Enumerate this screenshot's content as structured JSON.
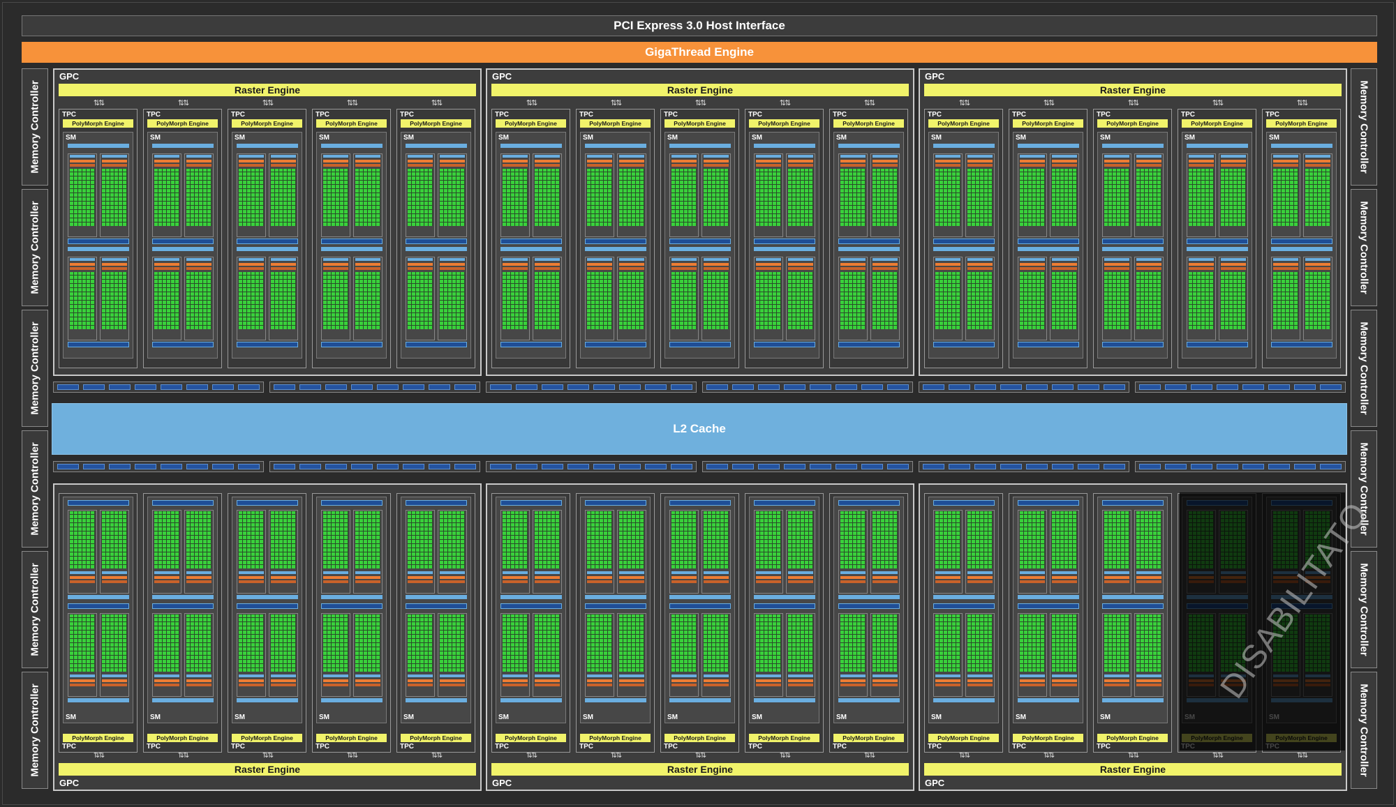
{
  "header": {
    "pci_label": "PCI Express 3.0 Host Interface",
    "gigathread_label": "GigaThread Engine"
  },
  "l2_cache_label": "L2 Cache",
  "memory_controller_label": "Memory Controller",
  "gpc_label": "GPC",
  "raster_engine_label": "Raster Engine",
  "tpc_label": "TPC",
  "polymorph_label": "PolyMorph Engine",
  "sm_label": "SM",
  "disabled_label": "DISABILITATO",
  "colors": {
    "background": "#2b2b2b",
    "gigathread": "#f7923a",
    "raster_polymorph": "#f1f36a",
    "l2_cache": "#6fb0dd",
    "cuda_core": "#39d13b",
    "load_store": "#1f4e96",
    "register_file": "#ee7d33"
  },
  "layout_summary": {
    "gpc_count": 6,
    "tpc_per_gpc": 5,
    "sm_per_tpc": 1,
    "memory_controllers": 12,
    "disabled_tpcs": 2
  }
}
